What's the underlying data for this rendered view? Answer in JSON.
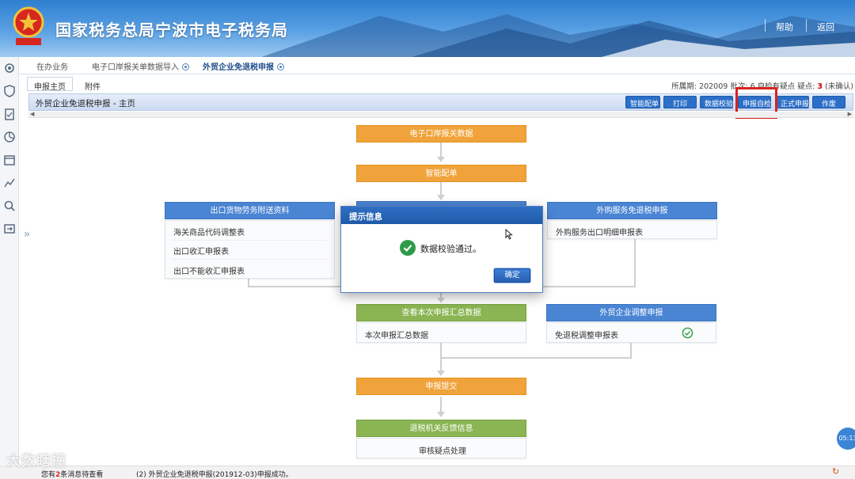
{
  "header": {
    "title": "国家税务总局宁波市电子税务局",
    "links": [
      "帮助",
      "返回"
    ]
  },
  "nav_tabs": [
    {
      "label": "在办业务",
      "active": false
    },
    {
      "label": "电子口岸报关单数据导入",
      "active": false
    },
    {
      "label": "外贸企业免退税申报",
      "active": true
    }
  ],
  "sub_tabs": [
    {
      "label": "申报主页"
    },
    {
      "label": "附件"
    }
  ],
  "period": {
    "label": "所属期:",
    "value": "202009",
    "batch_label": "批次:",
    "batch_value": "6",
    "check_label": "自检有疑点",
    "doubt_label": "疑点:",
    "doubt_value": "3",
    "unconfirmed": "(未确认)"
  },
  "title_bar": {
    "title": "外贸企业免退税申报 - 主页"
  },
  "toolbar": [
    "智能配单",
    "打印",
    "数据校验",
    "申报自检",
    "正式申报",
    "作废"
  ],
  "flow": {
    "step1": "电子口岸报关数据",
    "step2": "智能配单",
    "left_panel": {
      "title": "出口货物劳务附送资料",
      "items": [
        "海关商品代码调整表",
        "出口收汇申报表",
        "出口不能收汇申报表"
      ]
    },
    "right_panel": {
      "title": "外购服务免退税申报",
      "items": [
        "外购服务出口明细申报表"
      ]
    },
    "summary": {
      "title": "查看本次申报汇总数据",
      "items": [
        "本次申报汇总数据"
      ]
    },
    "adjust": {
      "title": "外贸企业调整申报",
      "items": [
        "免退税调整申报表"
      ]
    },
    "submit": "申报提交",
    "feedback": {
      "title": "退税机关反馈信息",
      "items": [
        "审核疑点处理"
      ]
    }
  },
  "modal": {
    "title": "提示信息",
    "message": "数据校验通过。",
    "ok_label": "确定"
  },
  "footer": {
    "notice_prefix": "您有",
    "notice_count": "2",
    "notice_suffix": "条消息待查看",
    "status": "(2)  外贸企业免退税申报(201912-03)申报成功。"
  },
  "watermark": "大数瞎撞",
  "clock": "05:13"
}
